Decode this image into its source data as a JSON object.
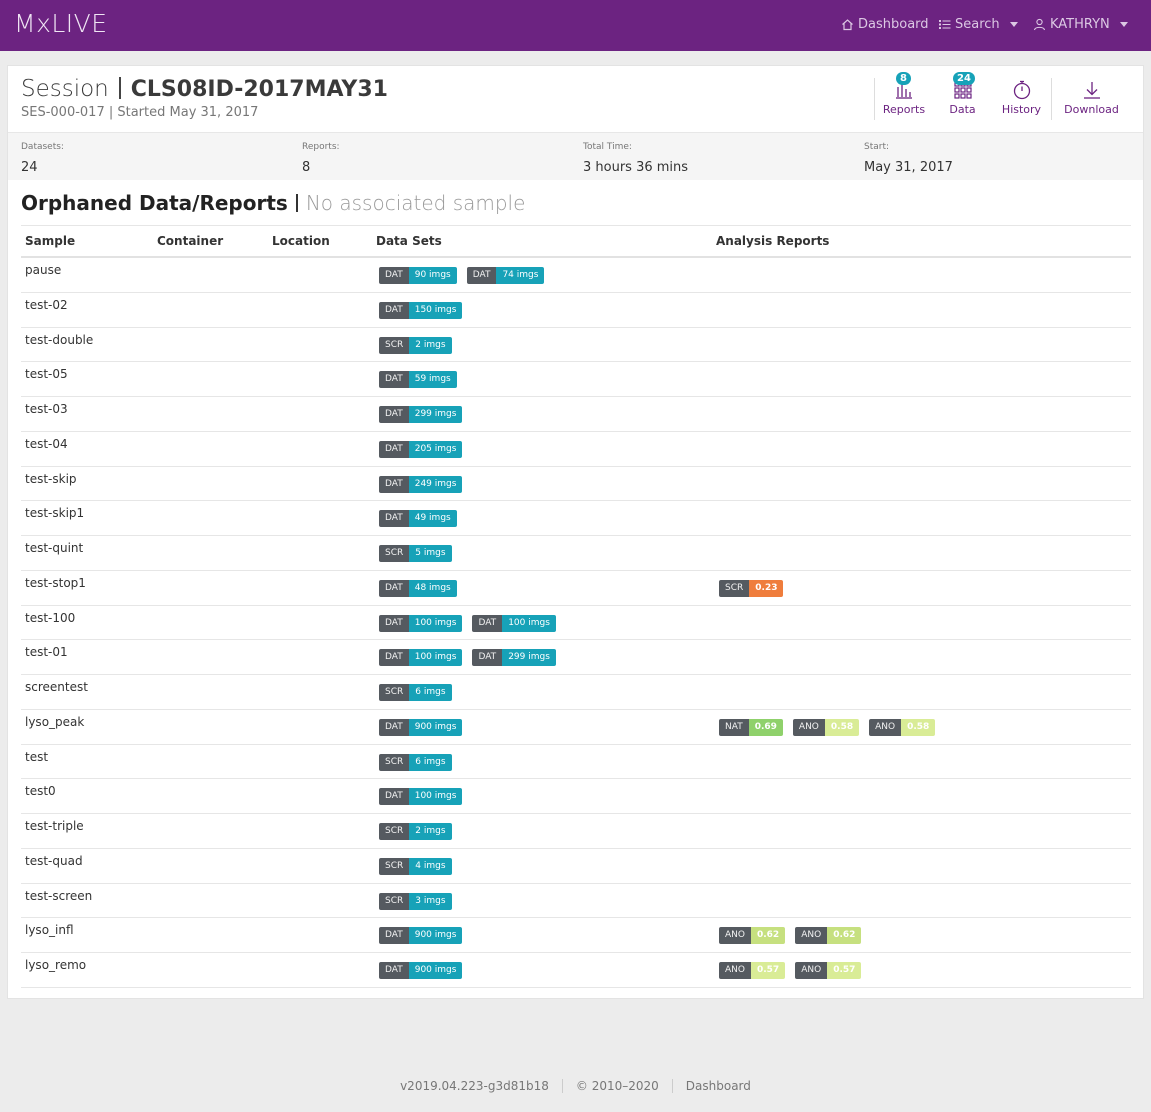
{
  "app": {
    "brand": "MxLIVE"
  },
  "nav": {
    "dashboard": "Dashboard",
    "search": "Search",
    "user": "KATHRYN"
  },
  "session": {
    "label": "Session",
    "name": "CLS08ID-2017MAY31",
    "subtitle": "SES-000-017 | Started May 31, 2017"
  },
  "tools": {
    "reports": {
      "label": "Reports",
      "badge": "8"
    },
    "data": {
      "label": "Data",
      "badge": "24"
    },
    "history": {
      "label": "History"
    },
    "download": {
      "label": "Download"
    }
  },
  "stats": [
    {
      "label": "Datasets:",
      "value": "24"
    },
    {
      "label": "Reports:",
      "value": "8"
    },
    {
      "label": "Total Time:",
      "value": "3 hours 36 mins"
    },
    {
      "label": "Start:",
      "value": "May 31, 2017"
    }
  ],
  "section": {
    "title": "Orphaned Data/Reports",
    "subtitle": "No associated sample"
  },
  "table": {
    "columns": [
      "Sample",
      "Container",
      "Location",
      "Data Sets",
      "Analysis Reports"
    ],
    "rows": [
      {
        "sample": "pause",
        "datasets": [
          {
            "kind": "DAT",
            "count": "90 imgs"
          },
          {
            "kind": "DAT",
            "count": "74 imgs"
          }
        ],
        "reports": []
      },
      {
        "sample": "test-02",
        "datasets": [
          {
            "kind": "DAT",
            "count": "150 imgs"
          }
        ],
        "reports": []
      },
      {
        "sample": "test-double",
        "datasets": [
          {
            "kind": "SCR",
            "count": "2 imgs"
          }
        ],
        "reports": []
      },
      {
        "sample": "test-05",
        "datasets": [
          {
            "kind": "DAT",
            "count": "59 imgs"
          }
        ],
        "reports": []
      },
      {
        "sample": "test-03",
        "datasets": [
          {
            "kind": "DAT",
            "count": "299 imgs"
          }
        ],
        "reports": []
      },
      {
        "sample": "test-04",
        "datasets": [
          {
            "kind": "DAT",
            "count": "205 imgs"
          }
        ],
        "reports": []
      },
      {
        "sample": "test-skip",
        "datasets": [
          {
            "kind": "DAT",
            "count": "249 imgs"
          }
        ],
        "reports": []
      },
      {
        "sample": "test-skip1",
        "datasets": [
          {
            "kind": "DAT",
            "count": "49 imgs"
          }
        ],
        "reports": []
      },
      {
        "sample": "test-quint",
        "datasets": [
          {
            "kind": "SCR",
            "count": "5 imgs"
          }
        ],
        "reports": []
      },
      {
        "sample": "test-stop1",
        "datasets": [
          {
            "kind": "DAT",
            "count": "48 imgs"
          }
        ],
        "reports": [
          {
            "kind": "SCR",
            "score": "0.23",
            "color": "red"
          }
        ]
      },
      {
        "sample": "test-100",
        "datasets": [
          {
            "kind": "DAT",
            "count": "100 imgs"
          },
          {
            "kind": "DAT",
            "count": "100 imgs"
          }
        ],
        "reports": []
      },
      {
        "sample": "test-01",
        "datasets": [
          {
            "kind": "DAT",
            "count": "100 imgs"
          },
          {
            "kind": "DAT",
            "count": "299 imgs"
          }
        ],
        "reports": []
      },
      {
        "sample": "screentest",
        "datasets": [
          {
            "kind": "SCR",
            "count": "6 imgs"
          }
        ],
        "reports": []
      },
      {
        "sample": "lyso_peak",
        "datasets": [
          {
            "kind": "DAT",
            "count": "900 imgs"
          }
        ],
        "reports": [
          {
            "kind": "NAT",
            "score": "0.69",
            "color": "green"
          },
          {
            "kind": "ANO",
            "score": "0.58",
            "color": "pale"
          },
          {
            "kind": "ANO",
            "score": "0.58",
            "color": "pale"
          }
        ]
      },
      {
        "sample": "test",
        "datasets": [
          {
            "kind": "SCR",
            "count": "6 imgs"
          }
        ],
        "reports": []
      },
      {
        "sample": "test0",
        "datasets": [
          {
            "kind": "DAT",
            "count": "100 imgs"
          }
        ],
        "reports": []
      },
      {
        "sample": "test-triple",
        "datasets": [
          {
            "kind": "SCR",
            "count": "2 imgs"
          }
        ],
        "reports": []
      },
      {
        "sample": "test-quad",
        "datasets": [
          {
            "kind": "SCR",
            "count": "4 imgs"
          }
        ],
        "reports": []
      },
      {
        "sample": "test-screen",
        "datasets": [
          {
            "kind": "SCR",
            "count": "3 imgs"
          }
        ],
        "reports": []
      },
      {
        "sample": "lyso_infl",
        "datasets": [
          {
            "kind": "DAT",
            "count": "900 imgs"
          }
        ],
        "reports": [
          {
            "kind": "ANO",
            "score": "0.62",
            "color": "lime"
          },
          {
            "kind": "ANO",
            "score": "0.62",
            "color": "lime"
          }
        ]
      },
      {
        "sample": "lyso_remo",
        "datasets": [
          {
            "kind": "DAT",
            "count": "900 imgs"
          }
        ],
        "reports": [
          {
            "kind": "ANO",
            "score": "0.57",
            "color": "pale"
          },
          {
            "kind": "ANO",
            "score": "0.57",
            "color": "pale"
          }
        ]
      }
    ]
  },
  "footer": {
    "version": "v2019.04.223-g3d81b18",
    "copyright": "© 2010–2020",
    "link": "Dashboard"
  },
  "colors": {
    "navbar": "#6c2381",
    "accent": "#17a2b8",
    "score_red": "#ef7d3c",
    "score_green": "#8fd16b"
  }
}
